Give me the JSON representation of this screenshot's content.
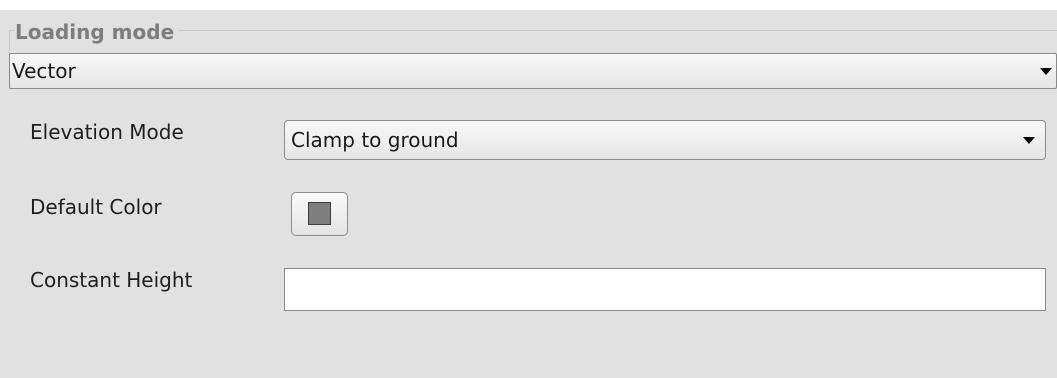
{
  "loading_mode": {
    "title": "Loading mode",
    "selected": "Vector"
  },
  "elevation_mode": {
    "label": "Elevation Mode",
    "selected": "Clamp to ground"
  },
  "default_color": {
    "label": "Default Color",
    "value": "#7f7f7f"
  },
  "constant_height": {
    "label": "Constant Height",
    "value": ""
  }
}
